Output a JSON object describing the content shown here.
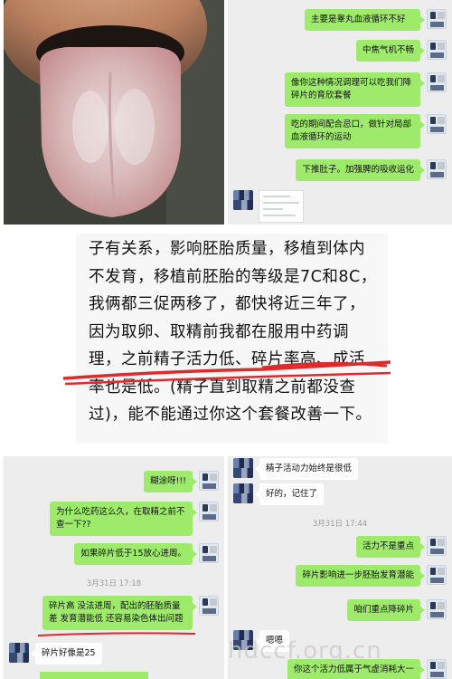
{
  "top_right": {
    "messages": [
      "主要是睾丸血液循环不好",
      "中焦气机不畅",
      "像你这种情况调理可以吃我们降碎片的育欣套餐",
      "吃的期间配合忌口，做针对局部血液循环的运动",
      "下推肚子。加强脾的吸收运化"
    ]
  },
  "big_text": {
    "content": "子有关系，影响胚胎质量，移植到体内不发育，移植前胚胎的等级是7C和8C，我俩都三促两移了，都快将近三年了，因为取卵、取精前我都在服用中药调理，之前精子活力低、碎片率高、成活率也是低。(精子直到取精之前都没查过)，能不能通过你这个套餐改善一下。"
  },
  "bottom_left": {
    "messages": [
      {
        "text": "糊涂呀!!!",
        "side": "right"
      },
      {
        "text": "为什么吃药这么久，在取精之前不查一下??",
        "side": "right"
      },
      {
        "text": "如果碎片低于15放心进周。",
        "side": "right"
      },
      {
        "text": "碎片高 没法进周，配出的胚胎质量差 发育潜能低 还容易染色体出问题",
        "side": "right"
      },
      {
        "text": "碎片好像是25",
        "side": "left"
      }
    ],
    "timestamp": "3月31日 17:18"
  },
  "bottom_right": {
    "messages": [
      {
        "text": "精子活动力始终是很低",
        "side": "left"
      },
      {
        "text": "好的，记住了",
        "side": "left"
      },
      {
        "text": "活力不是重点",
        "side": "right"
      },
      {
        "text": "碎片影响进一步胚胎发育潜能",
        "side": "right"
      },
      {
        "text": "咱们重点降碎片",
        "side": "right"
      },
      {
        "text": "嗯嗯",
        "side": "left"
      },
      {
        "text": "你这个活力低属于气虚消耗大一",
        "side": "right"
      }
    ],
    "timestamp": "3月31日 17:44"
  },
  "watermark": "hdccf.org.cn"
}
